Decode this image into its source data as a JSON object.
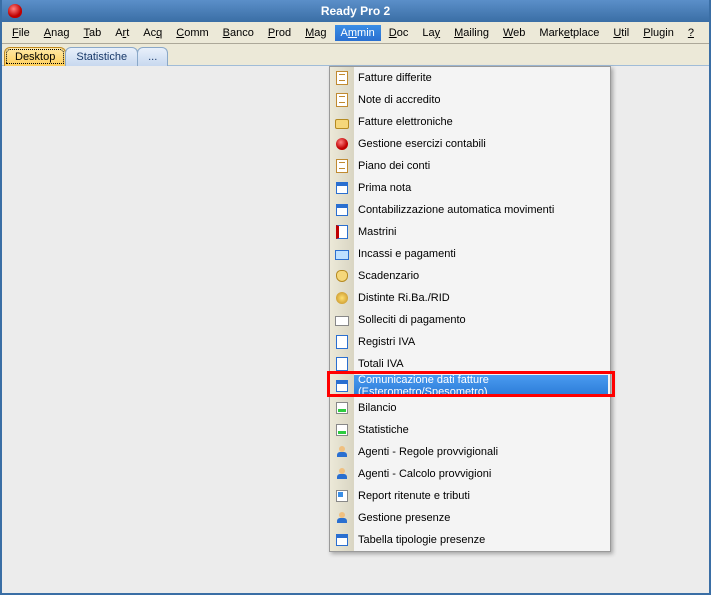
{
  "titlebar": {
    "title": "Ready Pro 2"
  },
  "menubar": {
    "items": [
      {
        "label": "File",
        "u": 0
      },
      {
        "label": "Anag",
        "u": 0
      },
      {
        "label": "Tab",
        "u": 0
      },
      {
        "label": "Art",
        "u": 1
      },
      {
        "label": "Acq",
        "u": 2
      },
      {
        "label": "Comm",
        "u": 0
      },
      {
        "label": "Banco",
        "u": 0
      },
      {
        "label": "Prod",
        "u": 0
      },
      {
        "label": "Mag",
        "u": 0
      },
      {
        "label": "Ammin",
        "u": 1,
        "active": true
      },
      {
        "label": "Doc",
        "u": 0
      },
      {
        "label": "Lay",
        "u": 2
      },
      {
        "label": "Mailing",
        "u": 0
      },
      {
        "label": "Web",
        "u": 0
      },
      {
        "label": "Marketplace",
        "u": 4
      },
      {
        "label": "Util",
        "u": 0
      },
      {
        "label": "Plugin",
        "u": 0
      },
      {
        "label": "?",
        "u": 0
      }
    ]
  },
  "tabs": {
    "items": [
      {
        "label": "Desktop",
        "active": true
      },
      {
        "label": "Statistiche",
        "active": false
      },
      {
        "label": "...",
        "active": false
      }
    ]
  },
  "dropdown": {
    "items": [
      {
        "icon": "doc-icon",
        "label": "Fatture differite"
      },
      {
        "icon": "doc-icon",
        "label": "Note di accredito"
      },
      {
        "icon": "folder-icon",
        "label": "Fatture elettroniche"
      },
      {
        "icon": "berry-icon",
        "label": "Gestione esercizi contabili"
      },
      {
        "icon": "doc-icon",
        "label": "Piano dei conti"
      },
      {
        "icon": "grid-icon",
        "label": "Prima nota"
      },
      {
        "icon": "grid-icon",
        "label": "Contabilizzazione automatica movimenti"
      },
      {
        "icon": "book-icon",
        "label": "Mastrini"
      },
      {
        "icon": "card-icon",
        "label": "Incassi e pagamenti"
      },
      {
        "icon": "bag-icon",
        "label": "Scadenzario"
      },
      {
        "icon": "coin-icon",
        "label": "Distinte Ri.Ba./RID"
      },
      {
        "icon": "mail-icon",
        "label": "Solleciti di pagamento"
      },
      {
        "icon": "page-icon",
        "label": "Registri IVA"
      },
      {
        "icon": "page-icon",
        "label": "Totali IVA"
      },
      {
        "icon": "grid-icon",
        "label": "Comunicazione dati fatture (Esterometro/Spesometro)",
        "selected": true
      },
      {
        "icon": "chart-icon",
        "label": "Bilancio"
      },
      {
        "icon": "chart-icon",
        "label": "Statistiche"
      },
      {
        "icon": "user-icon",
        "label": "Agenti - Regole provvigionali"
      },
      {
        "icon": "user-icon",
        "label": "Agenti - Calcolo provvigioni"
      },
      {
        "icon": "blocks-icon",
        "label": "Report ritenute e tributi"
      },
      {
        "icon": "user-icon",
        "label": "Gestione presenze"
      },
      {
        "icon": "grid-icon",
        "label": "Tabella tipologie presenze"
      }
    ]
  }
}
